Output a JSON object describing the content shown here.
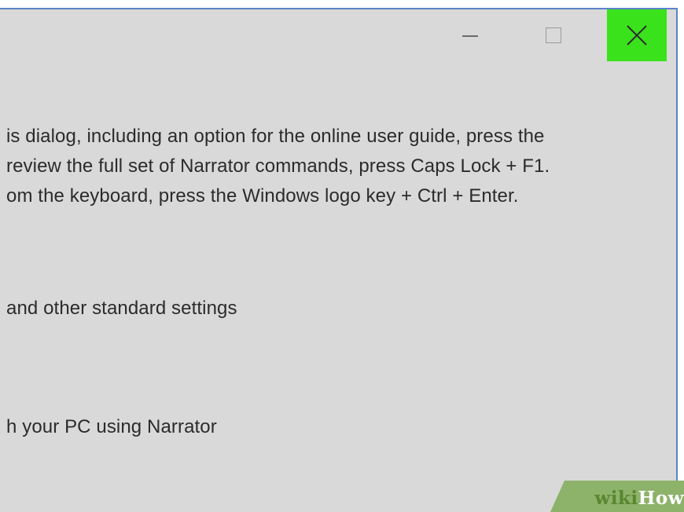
{
  "window": {
    "controls": {
      "minimize_icon": "minimize-icon",
      "maximize_icon": "maximize-icon",
      "close_icon": "close-icon",
      "close_highlight_color": "#39e21a"
    }
  },
  "content": {
    "lines": [
      "is dialog, including an option for the online user guide, press the",
      "review the full set of Narrator commands, press Caps Lock + F1.",
      "om the keyboard, press the Windows logo key + Ctrl + Enter.",
      "and other standard settings",
      "h your PC using Narrator"
    ]
  },
  "watermark": {
    "part1": "wiki",
    "part2": "How",
    "color": "#8db26a"
  }
}
